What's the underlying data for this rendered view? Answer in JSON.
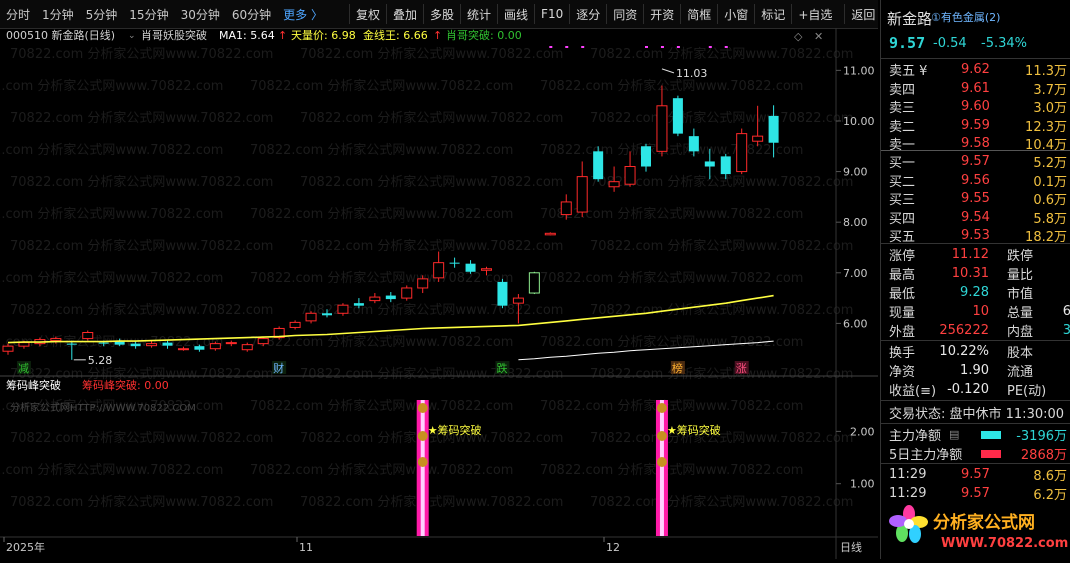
{
  "toolbar": {
    "periods": [
      "分时",
      "1分钟",
      "5分钟",
      "15分钟",
      "30分钟",
      "60分钟"
    ],
    "more": "更多 〉",
    "buttons": [
      "复权",
      "叠加",
      "多股",
      "统计",
      "画线",
      "F10",
      "逐分",
      "同资",
      "开资",
      "简框",
      "小窗",
      "标记",
      "+自选",
      "返回"
    ]
  },
  "chart_header": {
    "code_name": "000510 新金路(日线)",
    "indicator": "肖哥妖股突破",
    "ma1": "MA1: 5.64",
    "tianliang": "天量价: 6.98",
    "jinxian": "金线王: 6.66",
    "tupo": "肖哥突破: 0.00",
    "arrow": "↑"
  },
  "sub_header": {
    "name": "筹码峰突破",
    "value_label": "筹码峰突破: 0.00",
    "watermark": "分析家公式网HTTP://WWW.70822.COM"
  },
  "watermark_text": "70822.com 分析家公式网www.70822.com",
  "price_axis": [
    "11.00",
    "10.00",
    "9.00",
    "8.00",
    "7.00",
    "6.00"
  ],
  "sub_axis": [
    "2.00",
    "1.00"
  ],
  "date_axis": [
    "2025年",
    "11",
    "12",
    "日线"
  ],
  "annotations": {
    "high": "11.03",
    "low": "5.28",
    "signal": "★筹码突破",
    "markers": [
      "减",
      "财",
      "跌",
      "榜",
      "涨"
    ]
  },
  "chart_data": {
    "type": "candlestick",
    "ylim": [
      5.0,
      11.6
    ],
    "candles": [
      {
        "o": 5.45,
        "c": 5.55,
        "h": 5.6,
        "l": 5.38
      },
      {
        "o": 5.55,
        "c": 5.62,
        "h": 5.66,
        "l": 5.5
      },
      {
        "o": 5.6,
        "c": 5.68,
        "h": 5.72,
        "l": 5.55
      },
      {
        "o": 5.66,
        "c": 5.7,
        "h": 5.74,
        "l": 5.6
      },
      {
        "o": 5.6,
        "c": 5.58,
        "h": 5.66,
        "l": 5.28
      },
      {
        "o": 5.7,
        "c": 5.82,
        "h": 5.86,
        "l": 5.66
      },
      {
        "o": 5.62,
        "c": 5.6,
        "h": 5.66,
        "l": 5.55
      },
      {
        "o": 5.64,
        "c": 5.58,
        "h": 5.7,
        "l": 5.55
      },
      {
        "o": 5.6,
        "c": 5.55,
        "h": 5.64,
        "l": 5.5
      },
      {
        "o": 5.56,
        "c": 5.6,
        "h": 5.66,
        "l": 5.52
      },
      {
        "o": 5.62,
        "c": 5.56,
        "h": 5.66,
        "l": 5.5
      },
      {
        "o": 5.5,
        "c": 5.5,
        "h": 5.54,
        "l": 5.46
      },
      {
        "o": 5.55,
        "c": 5.48,
        "h": 5.58,
        "l": 5.44
      },
      {
        "o": 5.5,
        "c": 5.6,
        "h": 5.64,
        "l": 5.46
      },
      {
        "o": 5.6,
        "c": 5.62,
        "h": 5.66,
        "l": 5.55
      },
      {
        "o": 5.48,
        "c": 5.58,
        "h": 5.62,
        "l": 5.44
      },
      {
        "o": 5.6,
        "c": 5.7,
        "h": 5.74,
        "l": 5.55
      },
      {
        "o": 5.72,
        "c": 5.9,
        "h": 5.94,
        "l": 5.68
      },
      {
        "o": 5.92,
        "c": 6.02,
        "h": 6.06,
        "l": 5.88
      },
      {
        "o": 6.05,
        "c": 6.2,
        "h": 6.24,
        "l": 6.0
      },
      {
        "o": 6.2,
        "c": 6.16,
        "h": 6.28,
        "l": 6.12
      },
      {
        "o": 6.2,
        "c": 6.36,
        "h": 6.4,
        "l": 6.15
      },
      {
        "o": 6.4,
        "c": 6.35,
        "h": 6.5,
        "l": 6.3
      },
      {
        "o": 6.45,
        "c": 6.52,
        "h": 6.6,
        "l": 6.4
      },
      {
        "o": 6.55,
        "c": 6.48,
        "h": 6.62,
        "l": 6.42
      },
      {
        "o": 6.5,
        "c": 6.7,
        "h": 6.75,
        "l": 6.45
      },
      {
        "o": 6.7,
        "c": 6.88,
        "h": 6.95,
        "l": 6.6
      },
      {
        "o": 6.9,
        "c": 7.2,
        "h": 7.42,
        "l": 6.82
      },
      {
        "o": 7.2,
        "c": 7.18,
        "h": 7.3,
        "l": 7.1
      },
      {
        "o": 7.18,
        "c": 7.02,
        "h": 7.25,
        "l": 6.98
      },
      {
        "o": 7.05,
        "c": 7.08,
        "h": 7.12,
        "l": 6.95
      },
      {
        "o": 6.82,
        "c": 6.35,
        "h": 6.88,
        "l": 6.3
      },
      {
        "o": 6.4,
        "c": 6.5,
        "h": 6.58,
        "l": 6.0
      },
      {
        "o": 6.6,
        "c": 7.0,
        "h": 7.02,
        "l": 6.58
      },
      {
        "o": 7.75,
        "c": 7.78,
        "h": 7.8,
        "l": 7.74
      },
      {
        "o": 8.15,
        "c": 8.4,
        "h": 8.55,
        "l": 8.05
      },
      {
        "o": 8.2,
        "c": 8.9,
        "h": 9.2,
        "l": 8.1
      },
      {
        "o": 9.4,
        "c": 8.85,
        "h": 9.5,
        "l": 8.8
      },
      {
        "o": 8.7,
        "c": 8.8,
        "h": 9.1,
        "l": 8.6
      },
      {
        "o": 8.75,
        "c": 9.1,
        "h": 9.4,
        "l": 8.7
      },
      {
        "o": 9.5,
        "c": 9.1,
        "h": 9.55,
        "l": 9.0
      },
      {
        "o": 9.4,
        "c": 10.3,
        "h": 10.7,
        "l": 9.3
      },
      {
        "o": 10.45,
        "c": 9.75,
        "h": 10.5,
        "l": 9.7
      },
      {
        "o": 9.7,
        "c": 9.4,
        "h": 9.85,
        "l": 9.3
      },
      {
        "o": 9.2,
        "c": 9.1,
        "h": 9.45,
        "l": 8.85
      },
      {
        "o": 9.3,
        "c": 8.95,
        "h": 9.35,
        "l": 8.85
      },
      {
        "o": 9.0,
        "c": 9.75,
        "h": 9.85,
        "l": 8.95
      },
      {
        "o": 9.6,
        "c": 9.7,
        "h": 10.3,
        "l": 9.5
      },
      {
        "o": 10.1,
        "c": 9.57,
        "h": 10.31,
        "l": 9.28
      }
    ],
    "ma1": [
      5.62,
      5.63,
      5.63,
      5.64,
      5.64,
      5.64,
      5.64,
      5.65,
      5.65,
      5.66,
      5.67,
      5.68,
      5.69,
      5.7,
      5.71,
      5.72,
      5.73,
      5.74,
      5.76,
      5.77,
      5.78,
      5.8,
      5.82,
      5.84,
      5.86,
      5.88,
      5.9,
      5.91,
      5.92,
      5.93,
      5.94,
      5.95,
      5.96,
      5.99,
      6.02,
      6.05,
      6.08,
      6.11,
      6.14,
      6.17,
      6.2,
      6.24,
      6.28,
      6.32,
      6.36,
      6.4,
      6.45,
      6.5,
      6.55
    ],
    "jinxian": [
      null,
      null,
      null,
      null,
      null,
      null,
      null,
      null,
      null,
      null,
      null,
      null,
      null,
      null,
      null,
      null,
      null,
      null,
      null,
      null,
      null,
      null,
      null,
      null,
      null,
      null,
      null,
      null,
      null,
      null,
      null,
      null,
      5.28,
      5.3,
      5.33,
      5.35,
      5.38,
      5.41,
      5.43,
      5.46,
      5.48,
      5.5,
      5.52,
      5.54,
      5.56,
      5.58,
      5.6,
      5.62,
      5.65
    ]
  },
  "quote": {
    "name": "新金路",
    "industry": "①有色金属(2)",
    "price": "9.57",
    "change": "-0.54",
    "pct": "-5.34%",
    "asks": [
      {
        "label": "卖五 ¥",
        "price": "9.62",
        "vol": "11.3万"
      },
      {
        "label": "卖四",
        "price": "9.61",
        "vol": "3.7万"
      },
      {
        "label": "卖三",
        "price": "9.60",
        "vol": "3.0万"
      },
      {
        "label": "卖二",
        "price": "9.59",
        "vol": "12.3万"
      },
      {
        "label": "卖一",
        "price": "9.58",
        "vol": "10.4万"
      }
    ],
    "bids": [
      {
        "label": "买一",
        "price": "9.57",
        "vol": "5.2万"
      },
      {
        "label": "买二",
        "price": "9.56",
        "vol": "0.1万"
      },
      {
        "label": "买三",
        "price": "9.55",
        "vol": "0.6万"
      },
      {
        "label": "买四",
        "price": "9.54",
        "vol": "5.8万"
      },
      {
        "label": "买五",
        "price": "9.53",
        "vol": "18.2万"
      }
    ],
    "stats": [
      {
        "l1": "涨停",
        "v1": "11.12",
        "l2": "跌停"
      },
      {
        "l1": "最高",
        "v1": "10.31",
        "l2": "量比"
      },
      {
        "l1": "最低",
        "v1": "9.28",
        "l2": "市值"
      },
      {
        "l1": "现量",
        "v1": "10",
        "l2": "总量"
      },
      {
        "l1": "外盘",
        "v1": "256222",
        "l2": "内盘"
      }
    ],
    "stats_right": [
      "6",
      "3"
    ],
    "fund": [
      {
        "l1": "换手",
        "v1": "10.22%",
        "l2": "股本"
      },
      {
        "l1": "净资",
        "v1": "1.90",
        "l2": "流通"
      },
      {
        "l1": "收益(≡)",
        "v1": "-0.120",
        "l2": "PE(动)"
      }
    ],
    "status": "交易状态: 盘中休市 11:30:00",
    "main_net": {
      "label": "主力净额",
      "value": "-3196万"
    },
    "main_net5": {
      "label": "5日主力净额",
      "value": "2868万"
    },
    "ticks": [
      {
        "time": "11:29",
        "price": "9.57",
        "vol": "8.6万"
      },
      {
        "time": "11:29",
        "price": "9.57",
        "vol": "6.2万"
      }
    ],
    "logo_text": "分析家公式网",
    "logo_url": "WWW.70822.com"
  },
  "colors": {
    "up": "#ff2a2a",
    "down": "#2ee6e6",
    "ma": "#ffff40",
    "jin": "#ffffff",
    "pink": "#ff1aa8"
  }
}
